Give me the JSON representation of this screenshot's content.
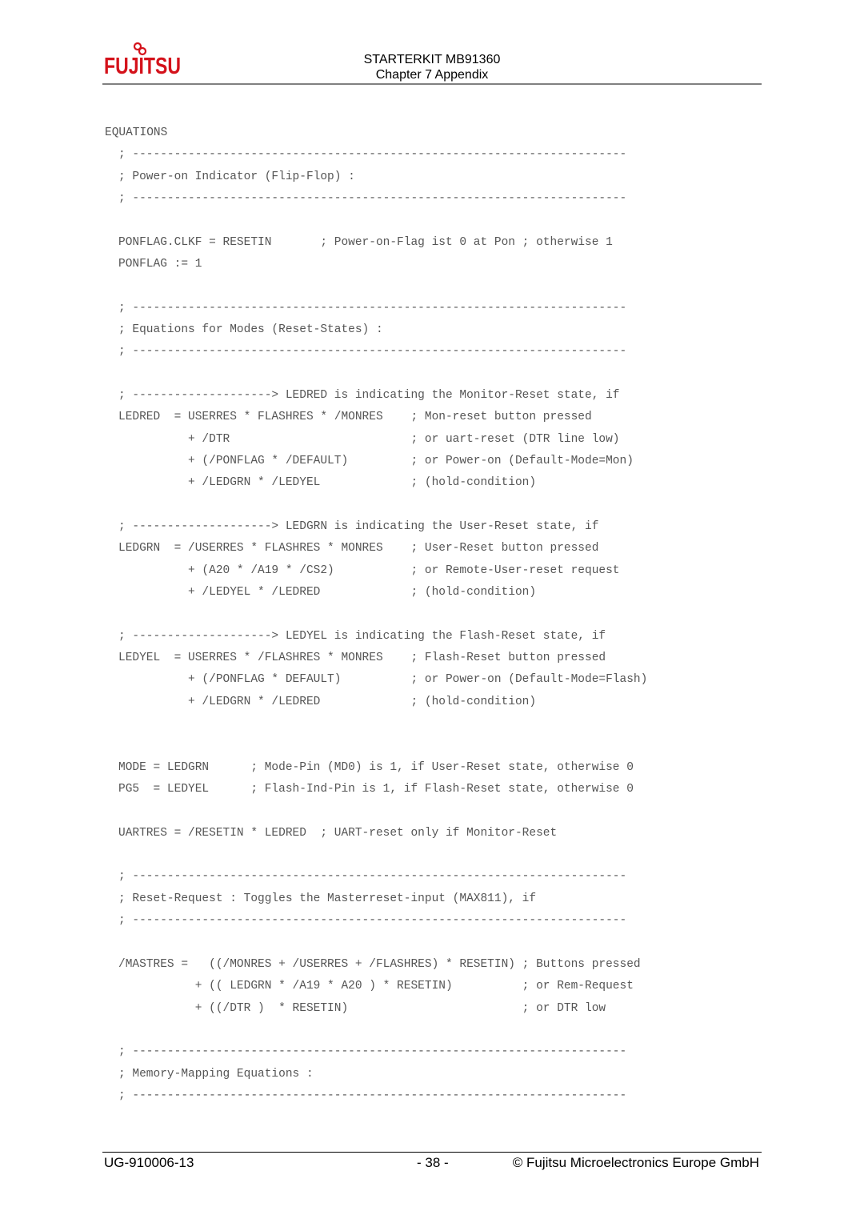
{
  "header": {
    "brand": "FUJITSU",
    "title": "STARTERKIT MB91360",
    "subtitle": "Chapter 7 Appendix"
  },
  "section_title": "EQUATIONS",
  "lines": [
    "; -----------------------------------------------------------------------",
    "; Power-on Indicator (Flip-Flop) :",
    "; -----------------------------------------------------------------------",
    "PONFLAG.CLKF = RESETIN       ; Power-on-Flag ist 0 at Pon ; otherwise 1",
    "PONFLAG := 1",
    "; -----------------------------------------------------------------------",
    "; Equations for Modes (Reset-States) :",
    "; -----------------------------------------------------------------------",
    "; --------------------> LEDRED is indicating the Monitor-Reset state, if",
    "LEDRED  = USERRES * FLASHRES * /MONRES    ; Mon-reset button pressed",
    "          + /DTR                          ; or uart-reset (DTR line low)",
    "          + (/PONFLAG * /DEFAULT)         ; or Power-on (Default-Mode=Mon)",
    "          + /LEDGRN * /LEDYEL             ; (hold-condition)",
    "; --------------------> LEDGRN is indicating the User-Reset state, if",
    "LEDGRN  = /USERRES * FLASHRES * MONRES    ; User-Reset button pressed",
    "          + (A20 * /A19 * /CS2)           ; or Remote-User-reset request",
    "          + /LEDYEL * /LEDRED             ; (hold-condition)",
    "; --------------------> LEDYEL is indicating the Flash-Reset state, if",
    "LEDYEL  = USERRES * /FLASHRES * MONRES    ; Flash-Reset button pressed",
    "          + (/PONFLAG * DEFAULT)          ; or Power-on (Default-Mode=Flash)",
    "          + /LEDGRN * /LEDRED             ; (hold-condition)",
    "MODE = LEDGRN      ; Mode-Pin (MD0) is 1, if User-Reset state, otherwise 0",
    "PG5  = LEDYEL      ; Flash-Ind-Pin is 1, if Flash-Reset state, otherwise 0",
    "UARTRES = /RESETIN * LEDRED  ; UART-reset only if Monitor-Reset",
    "; -----------------------------------------------------------------------",
    "; Reset-Request : Toggles the Masterreset-input (MAX811), if",
    "; -----------------------------------------------------------------------",
    "/MASTRES =   ((/MONRES + /USERRES + /FLASHRES) * RESETIN) ; Buttons pressed",
    "           + (( LEDGRN * /A19 * A20 ) * RESETIN)          ; or Rem-Request",
    "           + ((/DTR )  * RESETIN)                         ; or DTR low",
    "; -----------------------------------------------------------------------",
    "; Memory-Mapping Equations :",
    "; -----------------------------------------------------------------------"
  ],
  "footer": {
    "doc_id": "UG-910006-13",
    "page": "- 38 -",
    "copyright": "© Fujitsu Microelectronics Europe GmbH"
  }
}
